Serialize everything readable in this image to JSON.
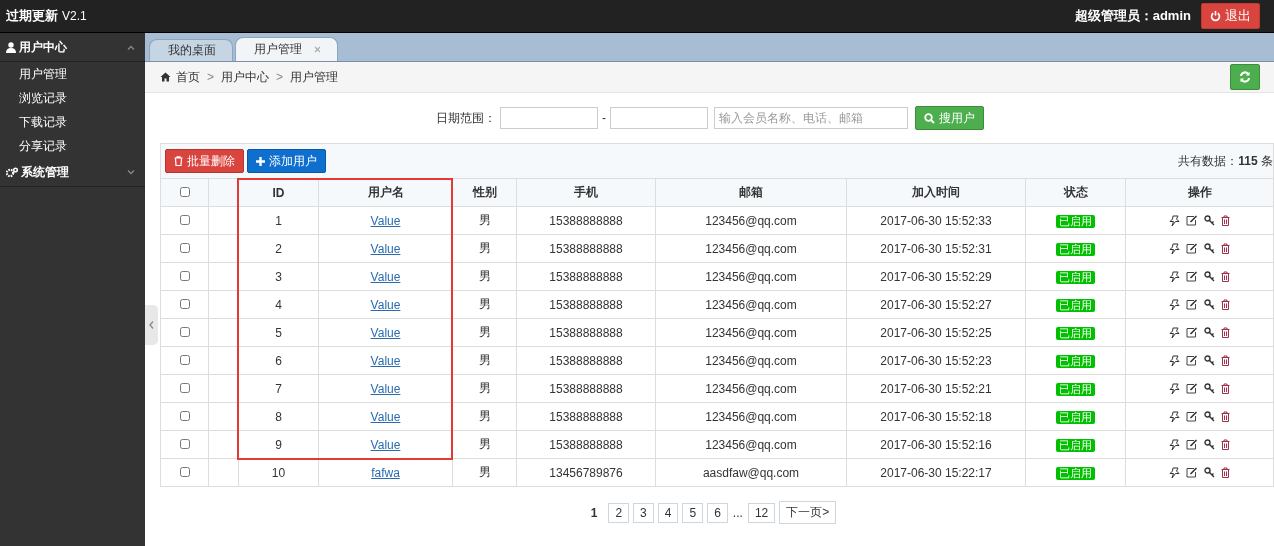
{
  "app": {
    "title": "过期更新",
    "version": "V2.1"
  },
  "user": {
    "label": "超级管理员：admin",
    "logout": "退出"
  },
  "sidebar": {
    "groups": [
      {
        "label": "用户中心",
        "expanded": true,
        "items": [
          "用户管理",
          "浏览记录",
          "下载记录",
          "分享记录"
        ]
      },
      {
        "label": "系统管理",
        "expanded": false
      }
    ]
  },
  "tabs": [
    {
      "label": "我的桌面",
      "selected": false,
      "closable": false
    },
    {
      "label": "用户管理",
      "selected": true,
      "closable": true
    }
  ],
  "breadcrumb": {
    "separator": ">",
    "items": [
      "首页",
      "用户中心",
      "用户管理"
    ]
  },
  "search": {
    "label": "日期范围：",
    "separator": "-",
    "keyword_placeholder": "输入会员名称、电话、邮箱",
    "button": "搜用户"
  },
  "toolbar": {
    "delete_button": "批量删除",
    "add_button": "添加用户",
    "total": "共有数据：**115** 条"
  },
  "table": {
    "header_checked": false,
    "columns": [
      "ID",
      "用户名",
      "性别",
      "手机",
      "邮箱",
      "加入时间",
      "状态",
      "操作"
    ],
    "rows": [
      {
        "checked": false,
        "id": "1",
        "name": "Value",
        "gender": "男",
        "phone": "15388888888",
        "email": "123456@qq.com",
        "joined": "2017-06-30 15:52:33",
        "status": "已启用"
      },
      {
        "checked": false,
        "id": "2",
        "name": "Value",
        "gender": "男",
        "phone": "15388888888",
        "email": "123456@qq.com",
        "joined": "2017-06-30 15:52:31",
        "status": "已启用"
      },
      {
        "checked": false,
        "id": "3",
        "name": "Value",
        "gender": "男",
        "phone": "15388888888",
        "email": "123456@qq.com",
        "joined": "2017-06-30 15:52:29",
        "status": "已启用"
      },
      {
        "checked": false,
        "id": "4",
        "name": "Value",
        "gender": "男",
        "phone": "15388888888",
        "email": "123456@qq.com",
        "joined": "2017-06-30 15:52:27",
        "status": "已启用"
      },
      {
        "checked": false,
        "id": "5",
        "name": "Value",
        "gender": "男",
        "phone": "15388888888",
        "email": "123456@qq.com",
        "joined": "2017-06-30 15:52:25",
        "status": "已启用"
      },
      {
        "checked": false,
        "id": "6",
        "name": "Value",
        "gender": "男",
        "phone": "15388888888",
        "email": "123456@qq.com",
        "joined": "2017-06-30 15:52:23",
        "status": "已启用"
      },
      {
        "checked": false,
        "id": "7",
        "name": "Value",
        "gender": "男",
        "phone": "15388888888",
        "email": "123456@qq.com",
        "joined": "2017-06-30 15:52:21",
        "status": "已启用"
      },
      {
        "checked": false,
        "id": "8",
        "name": "Value",
        "gender": "男",
        "phone": "15388888888",
        "email": "123456@qq.com",
        "joined": "2017-06-30 15:52:18",
        "status": "已启用"
      },
      {
        "checked": false,
        "id": "9",
        "name": "Value",
        "gender": "男",
        "phone": "15388888888",
        "email": "123456@qq.com",
        "joined": "2017-06-30 15:52:16",
        "status": "已启用"
      },
      {
        "checked": false,
        "id": "10",
        "name": "fafwa",
        "gender": "男",
        "phone": "13456789876",
        "email": "aasdfaw@qq.com",
        "joined": "2017-06-30 15:22:17",
        "status": "已启用"
      }
    ]
  },
  "pagination": {
    "pages": [
      {
        "kind": "page",
        "label": "1",
        "selected": true
      },
      {
        "kind": "page",
        "label": "2",
        "selected": false
      },
      {
        "kind": "page",
        "label": "3",
        "selected": false
      },
      {
        "kind": "page",
        "label": "4",
        "selected": false
      },
      {
        "kind": "page",
        "label": "5",
        "selected": false
      },
      {
        "kind": "page",
        "label": "6",
        "selected": false
      },
      {
        "kind": "ellipsis",
        "label": "..."
      },
      {
        "kind": "page",
        "label": "12",
        "selected": false
      }
    ],
    "next": "下一页>"
  }
}
